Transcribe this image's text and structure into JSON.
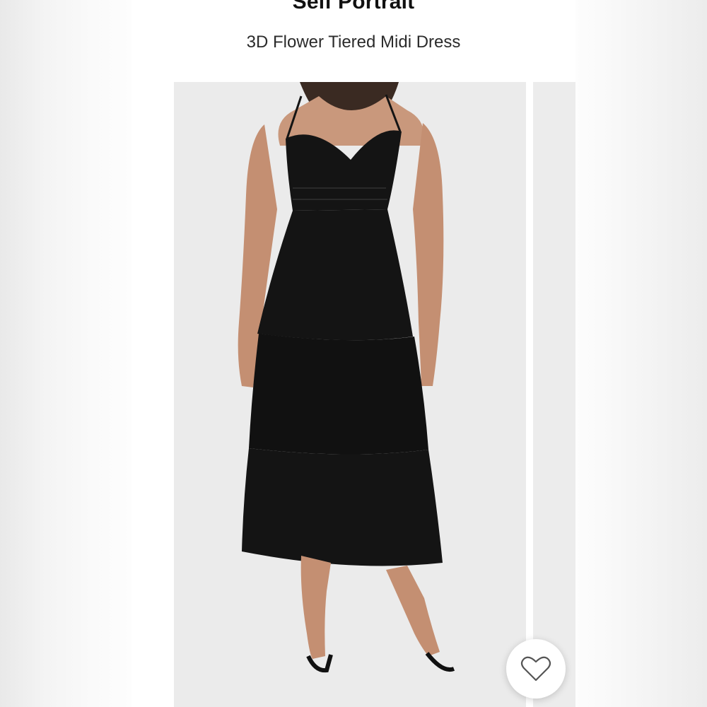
{
  "product": {
    "brand": "Self Portrait",
    "name": "3D Flower Tiered Midi Dress"
  },
  "gallery": {
    "current_image": "model-in-black-tiered-midi-dress",
    "background_color": "#ebebeb",
    "dress_color": "#141414"
  },
  "favorite": {
    "icon": "heart-outline-icon",
    "selected": false
  }
}
